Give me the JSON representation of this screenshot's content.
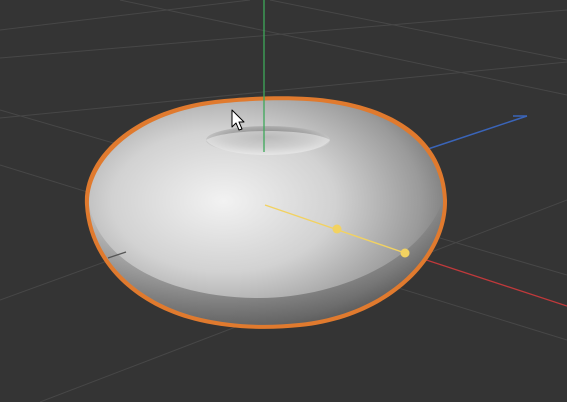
{
  "viewport": {
    "background": "#343434",
    "grid_color": "#444444",
    "selection_outline_color": "#e07a2e",
    "axes": {
      "x": {
        "name": "x-axis",
        "color": "#c0393b"
      },
      "y": {
        "name": "y-axis",
        "color": "#3ea85a"
      },
      "z": {
        "name": "z-axis",
        "color": "#3a64b8"
      }
    },
    "object": {
      "shape": "torus",
      "selected": true,
      "material": "default-gray"
    },
    "light_gizmo": {
      "color": "#f2d261",
      "handles": 2
    },
    "cursor": {
      "icon": "arrow-cursor-icon"
    }
  }
}
